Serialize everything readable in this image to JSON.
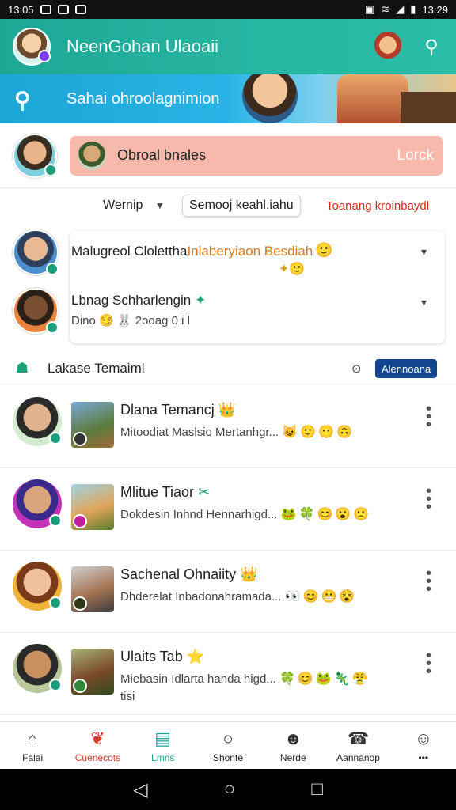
{
  "status": {
    "left_time": "13:05",
    "right_time": "13:29"
  },
  "appbar": {
    "title": "NeenGohan Ulaoaii"
  },
  "banner": {
    "text": "Sahai ohroolagnimion"
  },
  "profile": {
    "pill_text": "Obroal bnales",
    "pill_action": "Lorck"
  },
  "filters": {
    "label": "Wernip",
    "chip": "Semooj keahl.iahu",
    "red_link": "Toanang kroinbaydl"
  },
  "summary": {
    "line1_a": "Malugreol Clolettha",
    "line1_b": "Inlaberyiaon Besdiah",
    "line2": "Lbnag Schharlengin",
    "line3": "Dino 😏 🐰 2ooag 0 i l"
  },
  "section": {
    "title": "Lakase Temaiml",
    "button": "Alennoana"
  },
  "chats": [
    {
      "name": "Dlana Temancj",
      "tag": "👑",
      "message": "Mitoodiat Maslsio Mertanhgr...",
      "emojis": "😺🙂😶🙃",
      "extra": ""
    },
    {
      "name": "Mlitue Tiaor",
      "tag": "✂",
      "message": "Dokdesin Inhnd Hennarhigd...",
      "emojis": "🐸🍀😊😮🙁",
      "extra": ""
    },
    {
      "name": "Sachenal Ohnaiity",
      "tag": "👑",
      "message": "Dhderelat Inbadonahramada...",
      "emojis": "👀😊😬😵",
      "extra": ""
    },
    {
      "name": "Ulaits Tab",
      "tag": "⭐",
      "message": "Miebasin Idlarta handa higd...",
      "emojis": "🍀😊🐸🦎😤",
      "extra": "tisi"
    }
  ],
  "nav": [
    {
      "label": "Falai",
      "icon": "⌂"
    },
    {
      "label": "Cuenecots",
      "icon": "❦"
    },
    {
      "label": "Lmns",
      "icon": "▤"
    },
    {
      "label": "Shonte",
      "icon": "○"
    },
    {
      "label": "Nerde",
      "icon": "☻"
    },
    {
      "label": "Aannanop",
      "icon": "☎"
    },
    {
      "label": "•••",
      "icon": "☺"
    }
  ]
}
